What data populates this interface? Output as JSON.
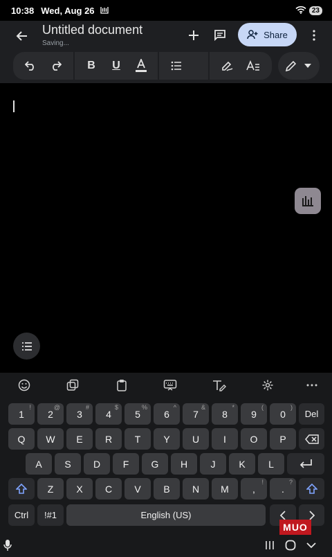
{
  "status_bar": {
    "time": "10:38",
    "date": "Wed, Aug 26",
    "battery": "23"
  },
  "header": {
    "title": "Untitled document",
    "subtitle": "Saving...",
    "share_label": "Share"
  },
  "keyboard": {
    "number_row": [
      {
        "label": "1",
        "sup": "!"
      },
      {
        "label": "2",
        "sup": "@"
      },
      {
        "label": "3",
        "sup": "#"
      },
      {
        "label": "4",
        "sup": "$"
      },
      {
        "label": "5",
        "sup": "%"
      },
      {
        "label": "6",
        "sup": "^"
      },
      {
        "label": "7",
        "sup": "&"
      },
      {
        "label": "8",
        "sup": "*"
      },
      {
        "label": "9",
        "sup": "("
      },
      {
        "label": "0",
        "sup": ")"
      }
    ],
    "del_label": "Del",
    "row_q": [
      "Q",
      "W",
      "E",
      "R",
      "T",
      "Y",
      "U",
      "I",
      "O",
      "P"
    ],
    "row_a": [
      "A",
      "S",
      "D",
      "F",
      "G",
      "H",
      "J",
      "K",
      "L"
    ],
    "row_z": [
      "Z",
      "X",
      "C",
      "V",
      "B",
      "N",
      "M"
    ],
    "comma": {
      "label": ",",
      "sup": "!"
    },
    "period": {
      "label": ".",
      "sup": "?"
    },
    "ctrl_label": "Ctrl",
    "symbols_label": "!#1",
    "space_label": "English (US)"
  },
  "watermark": "MUO",
  "colors": {
    "share_bg": "#c7d7f6",
    "shift_accent": "#7fa4ff",
    "header_bg": "#1e1f22"
  }
}
